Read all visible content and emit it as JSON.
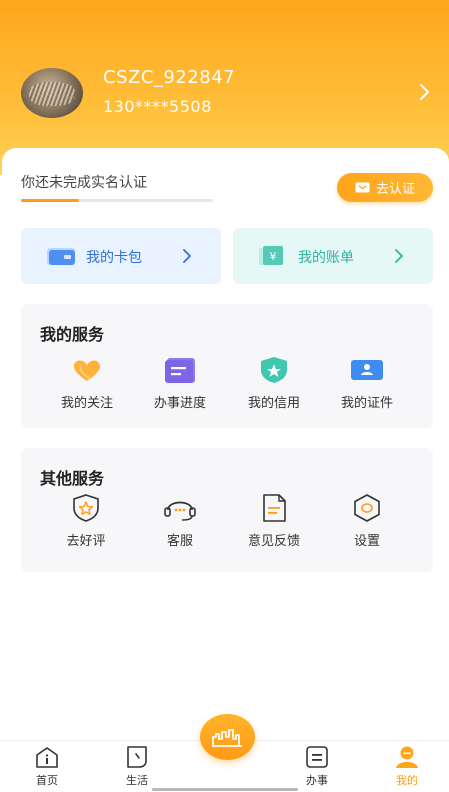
{
  "profile": {
    "username": "CSZC_922847",
    "phone": "130****5508"
  },
  "verification": {
    "text": "你还未完成实名认证",
    "button_label": "去认证",
    "progress": 0.3
  },
  "tiles": {
    "wallet_label": "我的卡包",
    "bill_label": "我的账单"
  },
  "my_services": {
    "title": "我的服务",
    "items": [
      {
        "label": "我的关注",
        "icon": "heart-icon"
      },
      {
        "label": "办事进度",
        "icon": "progress-list-icon"
      },
      {
        "label": "我的信用",
        "icon": "credit-shield-icon"
      },
      {
        "label": "我的证件",
        "icon": "id-card-icon"
      }
    ]
  },
  "other_services": {
    "title": "其他服务",
    "items": [
      {
        "label": "去好评",
        "icon": "star-shield-icon"
      },
      {
        "label": "客服",
        "icon": "headset-icon"
      },
      {
        "label": "意见反馈",
        "icon": "document-icon"
      },
      {
        "label": "设置",
        "icon": "hexagon-settings-icon"
      }
    ]
  },
  "tabbar": {
    "items": [
      {
        "label": "首页",
        "icon": "home-info-icon"
      },
      {
        "label": "生活",
        "icon": "life-icon"
      },
      {
        "label": "办事",
        "icon": "tasks-icon"
      },
      {
        "label": "我的",
        "icon": "user-icon",
        "active": true
      }
    ],
    "center_icon": "city-skyline-icon"
  },
  "colors": {
    "accent": "#ff9a1a",
    "header_top": "#ffa61c",
    "wallet_blue": "#2f6fd6",
    "bill_teal": "#2fb3a2"
  }
}
